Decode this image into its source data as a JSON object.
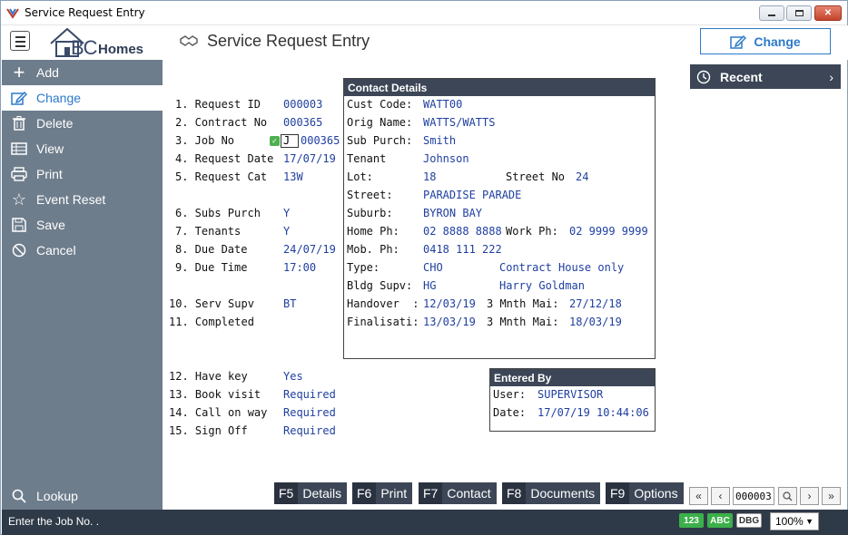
{
  "window": {
    "title": "Service Request Entry"
  },
  "header": {
    "logo_bc": "BC",
    "logo_homes": "Homes",
    "screen_title": "Service Request Entry",
    "mode_label": "Change"
  },
  "sidebar": {
    "items": [
      {
        "label": "Add",
        "icon": "plus-icon"
      },
      {
        "label": "Change",
        "icon": "edit-icon"
      },
      {
        "label": "Delete",
        "icon": "trash-icon"
      },
      {
        "label": "View",
        "icon": "table-icon"
      },
      {
        "label": "Print",
        "icon": "printer-icon"
      },
      {
        "label": "Event Reset",
        "icon": "star-icon"
      },
      {
        "label": "Save",
        "icon": "save-icon"
      },
      {
        "label": "Cancel",
        "icon": "cancel-icon"
      }
    ],
    "lookup_label": "Lookup"
  },
  "form": {
    "fields": [
      {
        "label": "1. Request ID",
        "value": "000003"
      },
      {
        "label": "2. Contract No",
        "value": "000365"
      },
      {
        "label": "3. Job No",
        "value": "000365",
        "input": "J"
      },
      {
        "label": "4. Request Date",
        "value": "17/07/19"
      },
      {
        "label": "5. Request Cat",
        "value": "13W"
      },
      {
        "label": "6. Subs Purch",
        "value": "Y"
      },
      {
        "label": "7. Tenants",
        "value": "Y"
      },
      {
        "label": "8. Due Date",
        "value": "24/07/19"
      },
      {
        "label": "9. Due Time",
        "value": "17:00"
      },
      {
        "label": "10. Serv Supv",
        "value": "BT"
      },
      {
        "label": "11. Completed",
        "value": ""
      },
      {
        "label": "12. Have key",
        "value": "Yes"
      },
      {
        "label": "13. Book visit",
        "value": "Required"
      },
      {
        "label": "14. Call on way",
        "value": "Required"
      },
      {
        "label": "15. Sign Off",
        "value": "Required"
      }
    ]
  },
  "contact": {
    "title": "Contact Details",
    "cust_code_label": "Cust Code:",
    "cust_code": "WATT00",
    "orig_name_label": "Orig Name:",
    "orig_name": "WATTS/WATTS",
    "sub_purch_label": "Sub Purch:",
    "sub_purch": "Smith",
    "tenant_label": "Tenant",
    "tenant": "Johnson",
    "lot_label": "Lot:",
    "lot": "18",
    "street_no_label": "Street No",
    "street_no": "24",
    "street_label": "Street:",
    "street": "PARADISE PARADE",
    "suburb_label": "Suburb:",
    "suburb": "BYRON BAY",
    "home_ph_label": "Home Ph:",
    "home_ph": "02 8888 8888",
    "work_ph_label": "Work Ph:",
    "work_ph": "02 9999 9999",
    "mob_ph_label": "Mob. Ph:",
    "mob_ph": "0418 111 222",
    "type_label": "Type:",
    "type": "CHO",
    "type_desc": "Contract House only",
    "bldg_supv_label": "Bldg Supv:",
    "bldg_supv": "HG",
    "bldg_supv_name": "Harry Goldman",
    "handover_label": "Handover  :",
    "handover": "12/03/19",
    "handover_mnth_label": "3 Mnth Mai:",
    "handover_mnth": "27/12/18",
    "finalisati_label": "Finalisati:",
    "finalisati": "13/03/19",
    "finalisati_mnth_label": "3 Mnth Mai:",
    "finalisati_mnth": "18/03/19"
  },
  "entered_by": {
    "title": "Entered By",
    "user_label": "User:",
    "user": "SUPERVISOR",
    "date_label": "Date:",
    "date": "17/07/19 10:44:06"
  },
  "recent": {
    "label": "Recent"
  },
  "fkeys": [
    {
      "key": "F5",
      "label": "Details"
    },
    {
      "key": "F6",
      "label": "Print"
    },
    {
      "key": "F7",
      "label": "Contact"
    },
    {
      "key": "F8",
      "label": "Documents"
    },
    {
      "key": "F9",
      "label": "Options"
    }
  ],
  "navigation": {
    "record": "000003"
  },
  "status": {
    "message": "Enter the Job No. .",
    "badge_123": "123",
    "badge_abc": "ABC",
    "badge_dbg": "DBG",
    "zoom": "100%"
  },
  "colors": {
    "sidebar": "#6e7d8c",
    "panel_header": "#3c4656",
    "accent": "#2c7ac9",
    "value_text": "#1f3fa0",
    "status_bar": "#2f3a48"
  }
}
